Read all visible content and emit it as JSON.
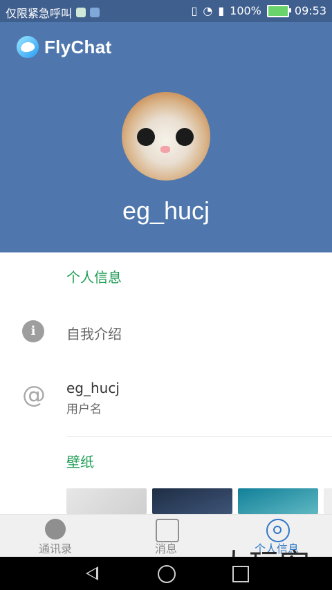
{
  "status_bar": {
    "carrier": "仅限紧急呼叫",
    "battery_percent": "100%",
    "time": "09:53"
  },
  "header": {
    "app_name": "FlyChat",
    "username": "eg_hucj"
  },
  "profile": {
    "section_title": "个人信息",
    "bio_label": "自我介绍",
    "username_value": "eg_hucj",
    "username_label": "用户名",
    "wallpaper_title": "壁纸"
  },
  "tabs": [
    {
      "label": "通讯录",
      "icon": "contacts-icon"
    },
    {
      "label": "消息",
      "icon": "chat-icon"
    },
    {
      "label": "个人信息",
      "icon": "settings-icon"
    }
  ],
  "watermark": "大玩客",
  "colors": {
    "header_bg": "#4f77ae",
    "status_bg": "#3f5f8e",
    "accent_green": "#1f9d55",
    "active_tab": "#2e78c7"
  }
}
